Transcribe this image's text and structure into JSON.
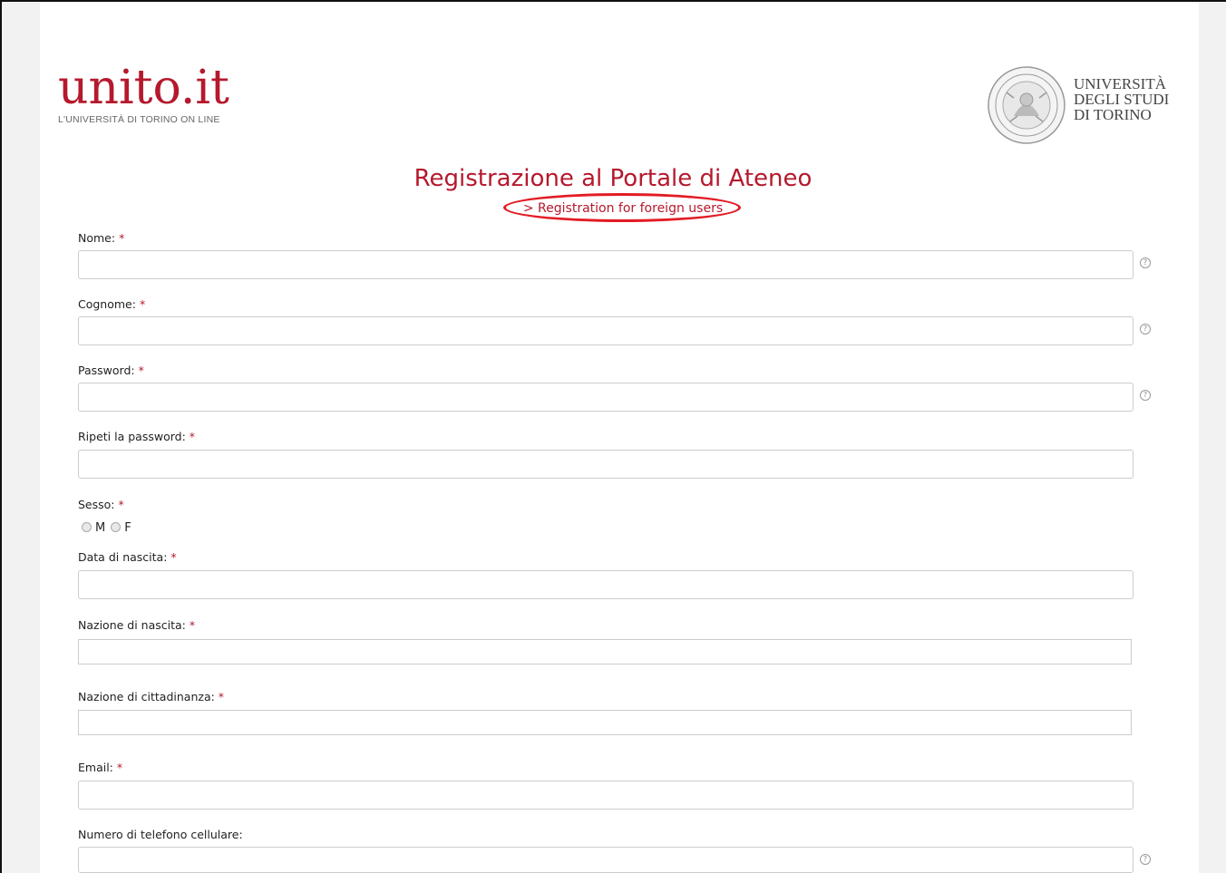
{
  "header": {
    "logo_wordmark": "unito.it",
    "logo_tagline": "L'UNIVERSITÀ DI TORINO ON LINE",
    "university_name_lines": [
      "UNIVERSITÀ",
      "DEGLI STUDI",
      "DI TORINO"
    ],
    "seal_icon": "university-seal-icon"
  },
  "page": {
    "title": "Registrazione al Portale di Ateneo",
    "foreign_link": "> Registration for foreign users"
  },
  "form": {
    "required_marker": "*",
    "help_icon_glyph": "?",
    "fields": {
      "nome": {
        "label": "Nome:",
        "value": ""
      },
      "cognome": {
        "label": "Cognome:",
        "value": ""
      },
      "password": {
        "label": "Password:",
        "value": ""
      },
      "ripeti_password": {
        "label": "Ripeti la password:",
        "value": ""
      },
      "sesso": {
        "label": "Sesso:",
        "options": [
          "M",
          "F"
        ]
      },
      "data_nascita": {
        "label": "Data di nascita:",
        "value": ""
      },
      "nazione_nascita": {
        "label": "Nazione di nascita:",
        "value": ""
      },
      "nazione_cittadinanza": {
        "label": "Nazione di cittadinanza:",
        "value": ""
      },
      "email": {
        "label": "Email:",
        "value": ""
      },
      "telefono": {
        "label": "Numero di telefono cellulare:",
        "value": ""
      }
    }
  },
  "colors": {
    "brand_red": "#b5192d",
    "highlight_red": "#e31b23",
    "gutter_gray": "#f2f2f2"
  }
}
